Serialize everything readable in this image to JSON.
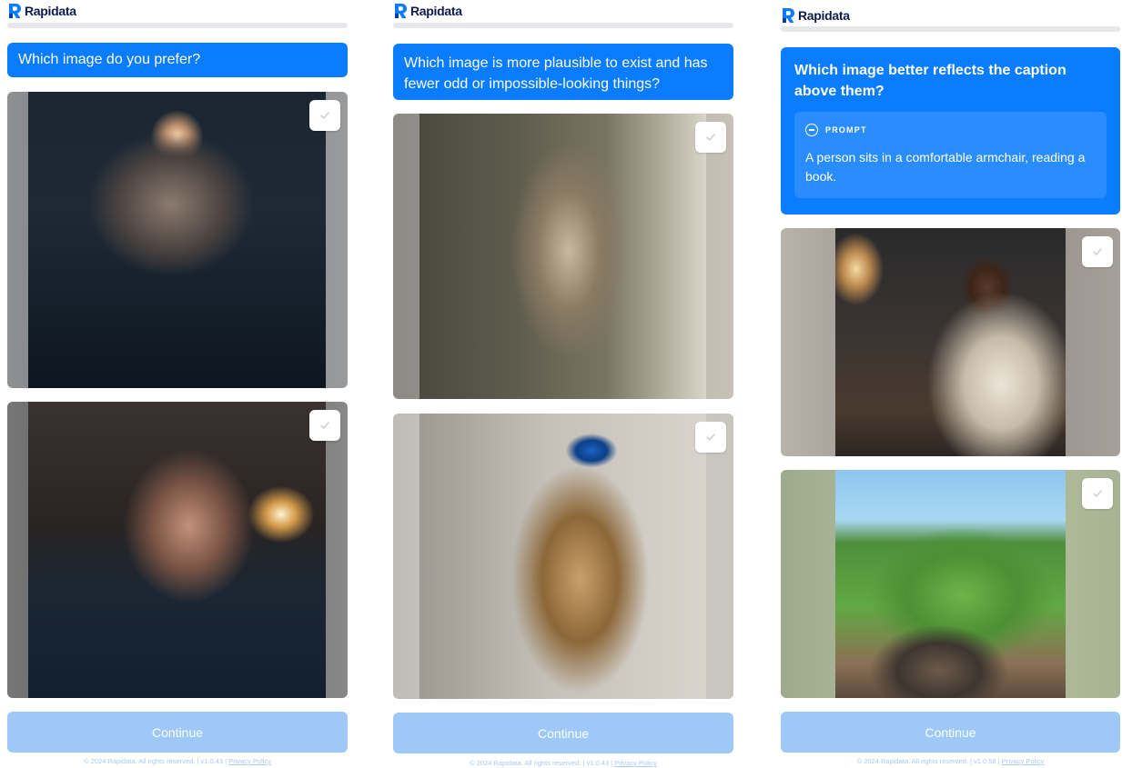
{
  "brand": {
    "name": "Rapidata",
    "logo_color": "#0a7cff",
    "accent": "#0a7cff"
  },
  "continue_label": "Continue",
  "panels": [
    {
      "question": "Which image do you prefer?",
      "images": [
        {
          "description": "elderly man with glasses and a headlamp in a dark room",
          "checked": false
        },
        {
          "description": "elderly bald man with a white beard beside a wall lamp",
          "checked": false
        }
      ],
      "footer": {
        "copyright": "© 2024 Rapidata. All rights reserved.",
        "version": "v1.0.43",
        "privacy": "Privacy Policy",
        "sep1": " | ",
        "sep2": " | "
      }
    },
    {
      "question": "Which image is more plausible to exist and has fewer odd or impossible-looking things?",
      "images": [
        {
          "description": "tabby kitten standing up against a wall reaching for a small bird",
          "checked": false
        },
        {
          "description": "tabby cat balancing on a wall with a blue kingfisher on its head",
          "checked": false
        }
      ],
      "footer": {
        "copyright": "© 2024 Rapidata. All rights reserved.",
        "version": "v1.0.43",
        "privacy": "Privacy Policy",
        "sep1": " | ",
        "sep2": " | "
      }
    },
    {
      "question": "Which image better reflects the caption above them?",
      "prompt": {
        "label": "PROMPT",
        "text": "A person sits in a comfortable armchair, reading a book."
      },
      "images": [
        {
          "description": "man in a cream sweater reading a book in a leather armchair by a lamp",
          "checked": false
        },
        {
          "description": "family barbecue in a sunny park with people and a dog playing",
          "checked": false
        }
      ],
      "footer": {
        "copyright": "© 2024 Rapidata. All rights reserved.",
        "version": "v1.0.58",
        "privacy": "Privacy Policy",
        "sep1": " | ",
        "sep2": " | "
      }
    }
  ]
}
